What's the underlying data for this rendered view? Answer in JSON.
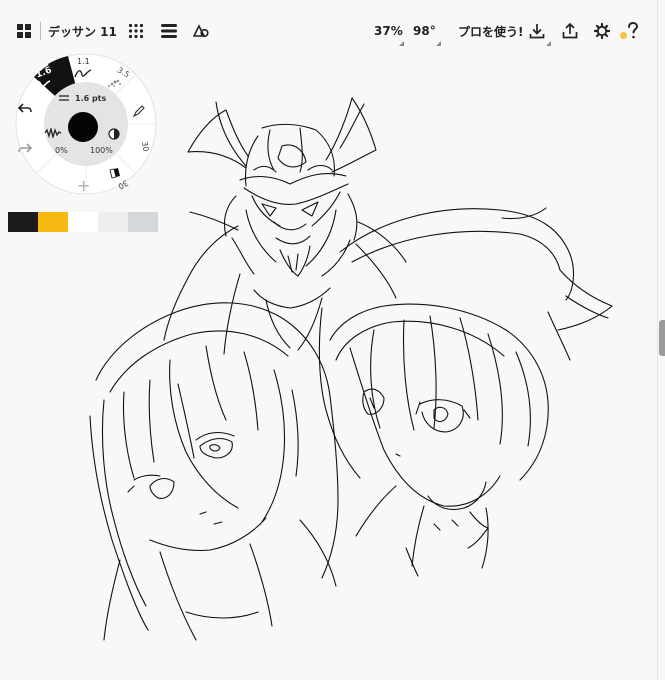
{
  "app": {
    "document_title": "デッサン 11",
    "zoom": "37%",
    "rotation": "98°",
    "pro_label": "プロを使う!"
  },
  "brush": {
    "active_size": "1.6",
    "size_option_2": "1.1",
    "size_option_3": "3.5",
    "size_readout": "1.6 pts",
    "opacity_min": "0%",
    "opacity_max": "100%",
    "tool_size_right": "30",
    "tool_size_bottom": "30",
    "add_label": "+"
  },
  "colors": {
    "accent": "#f6c343",
    "swatches": [
      "#1b1b1b",
      "#f6b913",
      "#ffffff",
      "#eceeef",
      "#d4d8db"
    ]
  },
  "icons": {
    "gallery": "grid-icon",
    "brushes": "dots-grid-icon",
    "layers": "layers-icon",
    "shapes": "shapes-icon",
    "export": "download-icon",
    "share": "share-icon",
    "settings": "gear-icon",
    "help": "question-icon",
    "undo": "undo-icon",
    "redo": "redo-icon"
  }
}
